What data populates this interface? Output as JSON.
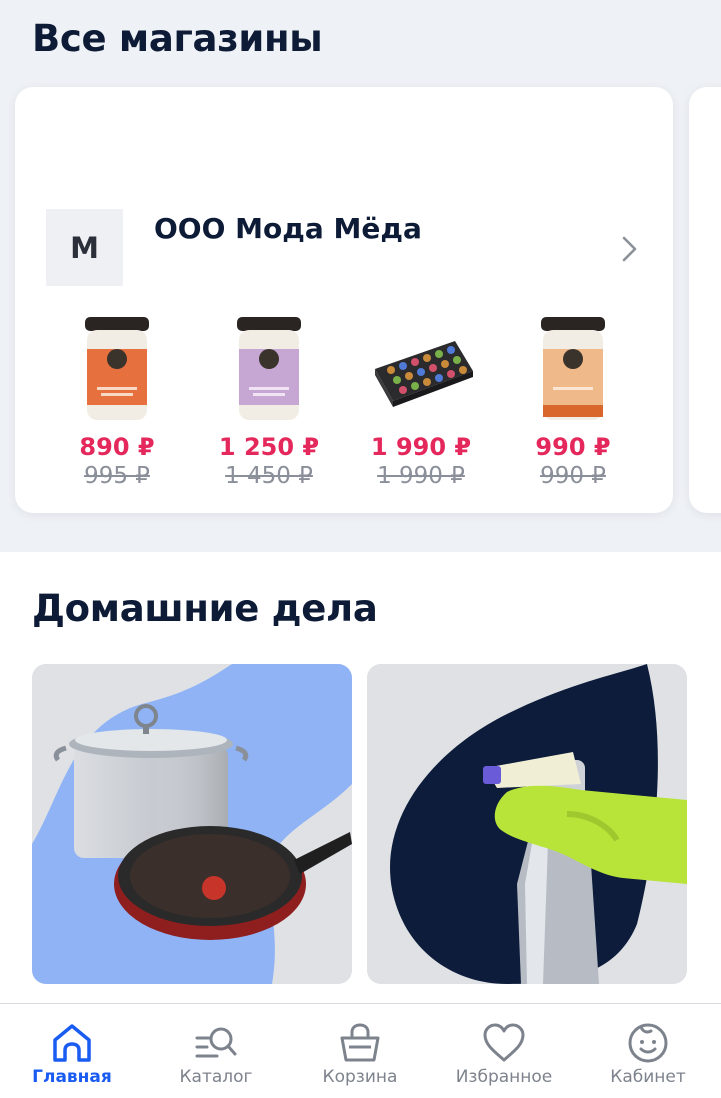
{
  "sections": {
    "all_shops_title": "Все магазины",
    "home_chores_title": "Домашние дела"
  },
  "shop": {
    "logo_letter": "М",
    "name": "ООО Мода Мёда",
    "products": [
      {
        "price": "890 ₽",
        "old_price": "995 ₽",
        "icon": "honey-jar-orange"
      },
      {
        "price": "1 250 ₽",
        "old_price": "1 450 ₽",
        "icon": "honey-jar-lilac"
      },
      {
        "price": "1 990 ₽",
        "old_price": "1 990 ₽",
        "icon": "honey-gift-box"
      },
      {
        "price": "990 ₽",
        "old_price": "990 ₽",
        "icon": "honey-jar-peach"
      }
    ]
  },
  "tiles": [
    {
      "icon": "cookware-pot-pan"
    },
    {
      "icon": "cleaning-spray-glove"
    }
  ],
  "tabbar": {
    "items": [
      {
        "label": "Главная",
        "icon": "home-icon",
        "active": true
      },
      {
        "label": "Каталог",
        "icon": "catalog-search-icon",
        "active": false
      },
      {
        "label": "Корзина",
        "icon": "basket-icon",
        "active": false
      },
      {
        "label": "Избранное",
        "icon": "heart-icon",
        "active": false
      },
      {
        "label": "Кабинет",
        "icon": "profile-face-icon",
        "active": false
      }
    ]
  },
  "colors": {
    "accent": "#1a5cf2",
    "price": "#e4285c",
    "heading": "#0d1b36"
  }
}
